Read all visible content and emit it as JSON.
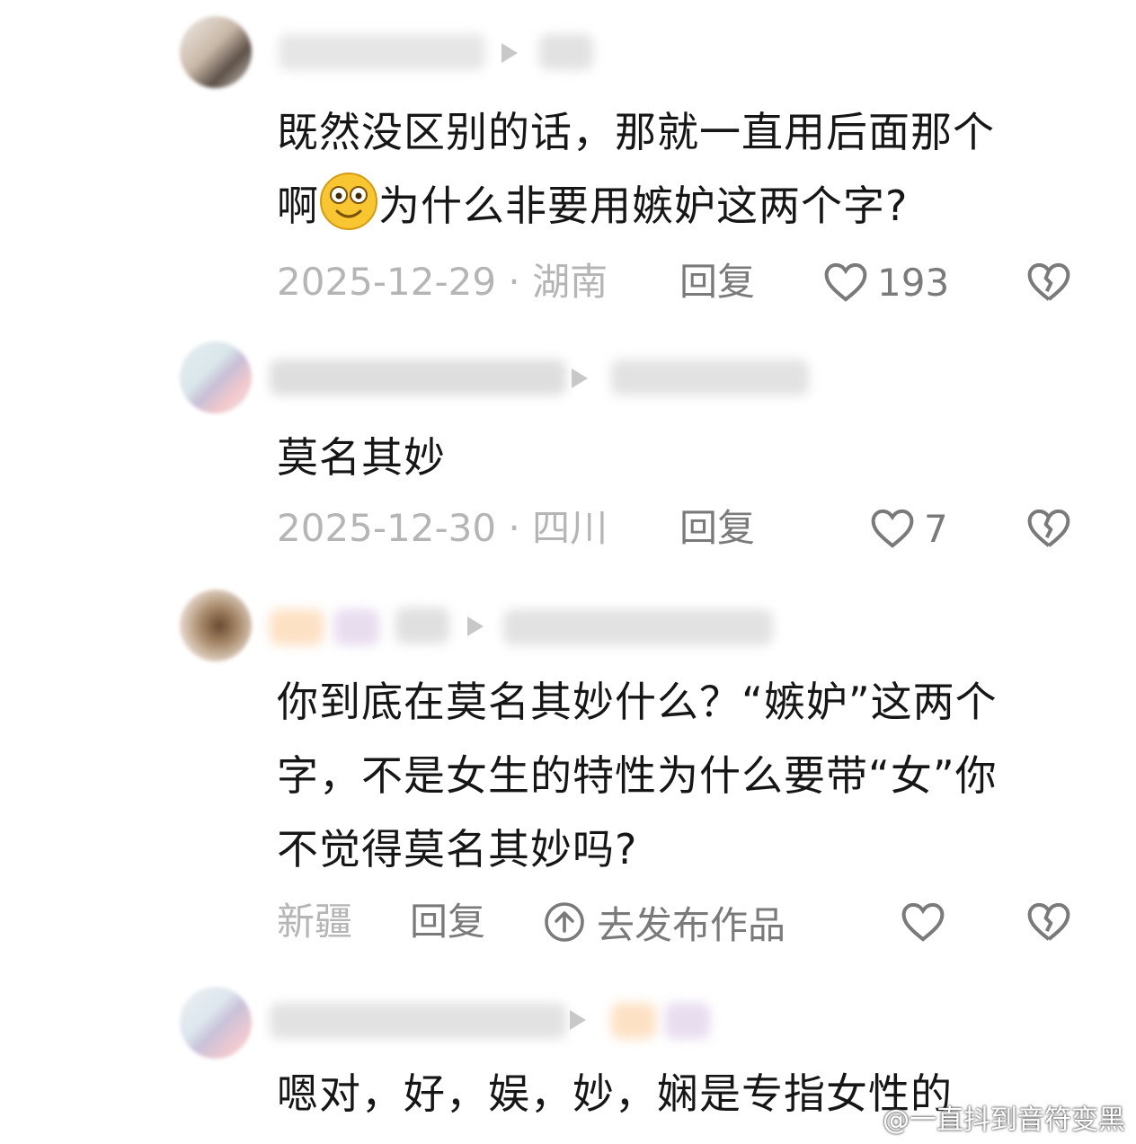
{
  "comments": [
    {
      "text_line1": "既然没区别的话，那就一直用后面那个",
      "text_line2_before": "啊",
      "text_line2_after": "为什么非要用嫉妒这两个字?",
      "meta": "2025-12-29 · 湖南",
      "reply": "回复",
      "likes": "193"
    },
    {
      "text": "莫名其妙",
      "meta": "2025-12-30 · 四川",
      "reply": "回复",
      "likes": "7"
    },
    {
      "text_line1": "你到底在莫名其妙什么？“嫉妒”这两个",
      "text_line2": "字，不是女生的特性为什么要带“女”你",
      "text_line3": "不觉得莫名其妙吗?",
      "meta": "新疆",
      "reply": "回复",
      "publish": "去发布作品"
    },
    {
      "text": "嗯对，好，娱，妙，娴是专指女性的"
    }
  ],
  "icons": [
    "play-arrow-icon",
    "heart-icon",
    "broken-heart-icon",
    "upload-circle-icon",
    "smile-emoji-icon",
    "weibo-logo-icon"
  ],
  "watermark": "@一直抖到音符变黑",
  "colors": {
    "text": "#161616",
    "meta": "#b5b5b5",
    "action": "#7a7a7a"
  }
}
